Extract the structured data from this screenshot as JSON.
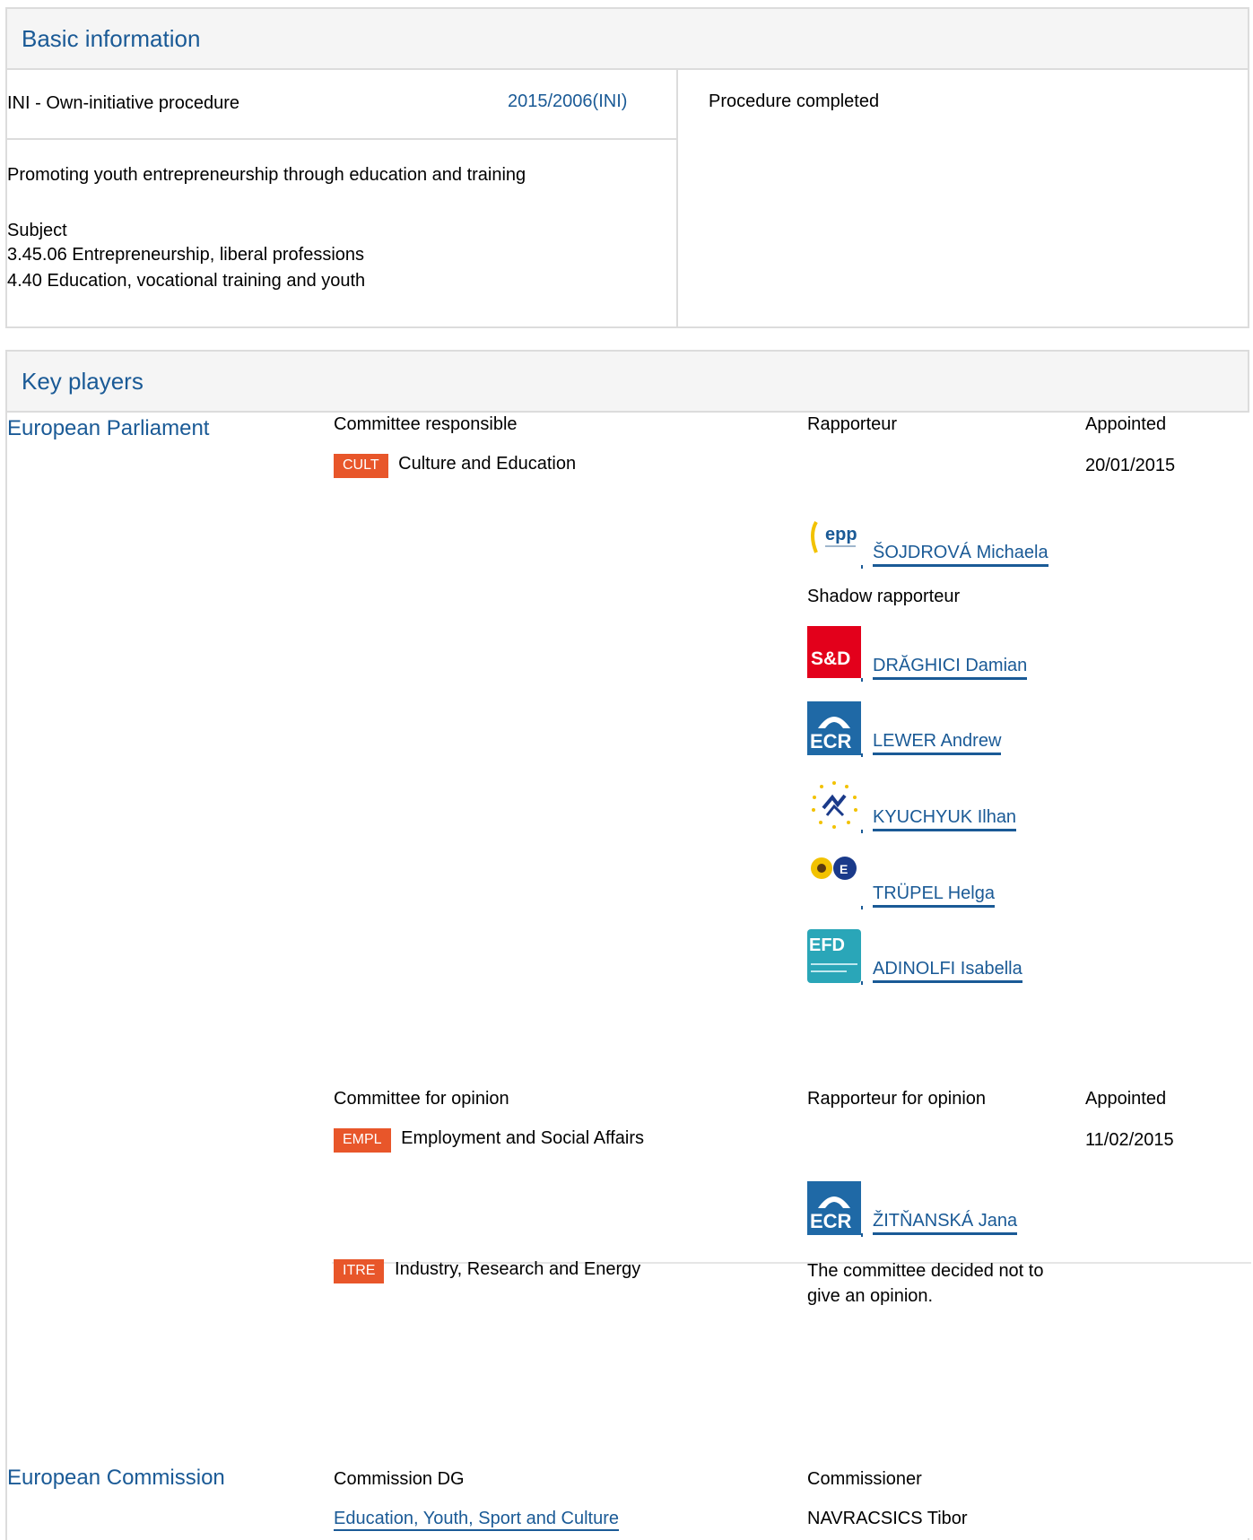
{
  "basic": {
    "title": "Basic information",
    "procedure_type": "INI - Own-initiative procedure",
    "procedure_ref": "2015/2006(INI)",
    "status": "Procedure completed",
    "procedure_title": "Promoting youth entrepreneurship through education and training",
    "subject_label": "Subject",
    "subjects": [
      "3.45.06 Entrepreneurship, liberal professions",
      "4.40 Education, vocational training and youth"
    ]
  },
  "players": {
    "title": "Key players",
    "ep_label": "European Parliament",
    "resp": {
      "col_committee": "Committee responsible",
      "col_rapporteur": "Rapporteur",
      "col_appointed": "Appointed",
      "committee_code": "CULT",
      "committee_name": "Culture and Education",
      "appointed": "20/01/2015",
      "rapporteur": {
        "name": "ŠOJDROVÁ Michaela",
        "group_logo": "epp-logo"
      },
      "shadow_label": "Shadow rapporteur",
      "shadows": [
        {
          "name": "DRĂGHICI Damian",
          "group_logo": "sd-logo",
          "logo_text": "S&D"
        },
        {
          "name": "LEWER Andrew",
          "group_logo": "ecr-logo",
          "logo_text": "ECR"
        },
        {
          "name": "KYUCHYUK Ilhan",
          "group_logo": "alde-logo"
        },
        {
          "name": "TRÜPEL Helga",
          "group_logo": "greens-logo"
        },
        {
          "name": "ADINOLFI Isabella",
          "group_logo": "efdd-logo",
          "logo_text": "EFD"
        }
      ]
    },
    "opinion": {
      "col_committee": "Committee for opinion",
      "col_rapporteur": "Rapporteur for opinion",
      "col_appointed": "Appointed",
      "committees": [
        {
          "code": "EMPL",
          "name": "Employment and Social Affairs",
          "appointed": "11/02/2015",
          "rapporteur": {
            "name": "ŽITŇANSKÁ Jana",
            "group_logo": "ecr-logo",
            "logo_text": "ECR"
          }
        },
        {
          "code": "ITRE",
          "name": "Industry, Research and Energy",
          "note_line1": "The committee decided not to",
          "note_line2": "give an opinion."
        }
      ]
    },
    "ec_label": "European Commission",
    "commission": {
      "col_dg": "Commission DG",
      "col_commissioner": "Commissioner",
      "dg": "Education, Youth, Sport and Culture",
      "commissioner": "NAVRACSICS Tibor"
    },
    "epp_text": "epp"
  },
  "colors": {
    "accent": "#1a5a96",
    "badge": "#e8562a",
    "border": "#dcdcdc",
    "header_bg": "#f5f5f5"
  }
}
